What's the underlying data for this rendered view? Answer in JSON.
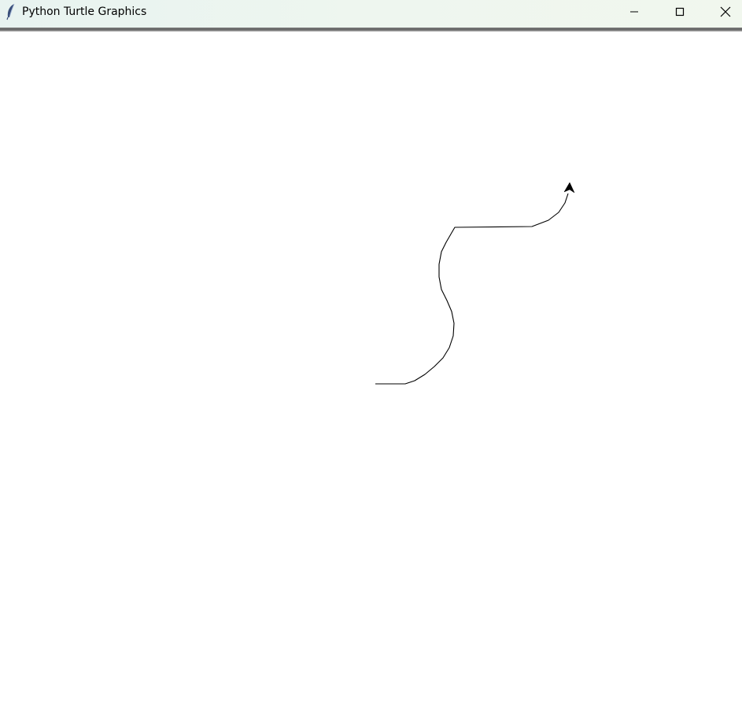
{
  "window": {
    "title": "Python Turtle Graphics",
    "app_icon": "feather-icon",
    "controls": {
      "minimize": "minimize-icon",
      "maximize": "maximize-icon",
      "close": "close-icon"
    }
  },
  "canvas": {
    "background": "#ffffff",
    "pen_color": "#000000",
    "turtle_shape": "classic-arrow",
    "turtle_color": "#000000"
  }
}
